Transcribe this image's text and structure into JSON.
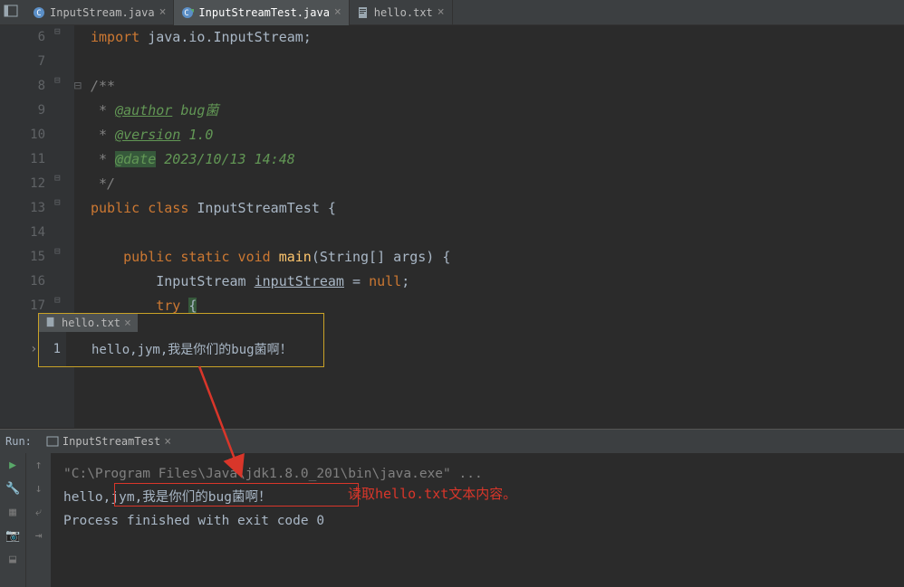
{
  "tabs": [
    {
      "label": "InputStream.java",
      "icon": "class"
    },
    {
      "label": "InputStreamTest.java",
      "icon": "class-run",
      "active": true
    },
    {
      "label": "hello.txt",
      "icon": "file"
    }
  ],
  "code": {
    "lines": [
      {
        "n": "6",
        "html": "<span class='kw'>import </span>java.io.InputStream;"
      },
      {
        "n": "7",
        "html": ""
      },
      {
        "n": "8",
        "html": "<span class='comment-i'>/**</span>"
      },
      {
        "n": "9",
        "html": "<span class='comment-i'> * </span><span class='doctag'>@author</span><span class='author'> bug菌</span>"
      },
      {
        "n": "10",
        "html": "<span class='comment-i'> * </span><span class='doctag'>@version</span><span class='author'> 1.0</span>"
      },
      {
        "n": "11",
        "html": "<span class='comment-i'> * </span><span class='doctag-hl'>@date</span><span class='author'> 2023/10/13 14:48</span>"
      },
      {
        "n": "12",
        "html": "<span class='comment-i'> */</span>"
      },
      {
        "n": "13",
        "html": "<span class='kw'>public class </span>InputStreamTest {"
      },
      {
        "n": "14",
        "html": ""
      },
      {
        "n": "15",
        "html": "    <span class='kw'>public static void </span><span class='methodname'>main</span>(String[] args) {"
      },
      {
        "n": "16",
        "html": "        InputStream <span class='ident-u'>inputStream</span> = <span class='kw'>null</span>;"
      },
      {
        "n": "17",
        "html": "        <span class='kw'>try </span><span style='background:#36593b'>{</span>"
      }
    ]
  },
  "popup": {
    "tab": "hello.txt",
    "line_no": "1",
    "content": "hello,jym,我是你们的bug菌啊！"
  },
  "run": {
    "label": "Run:",
    "tab": "InputStreamTest",
    "lines": [
      "\"C:\\Program Files\\Java\\jdk1.8.0_201\\bin\\java.exe\" ...",
      "hello,jym,我是你们的bug菌啊！",
      "",
      "Process finished with exit code 0"
    ]
  },
  "annotation": "读取hello.txt文本内容。"
}
